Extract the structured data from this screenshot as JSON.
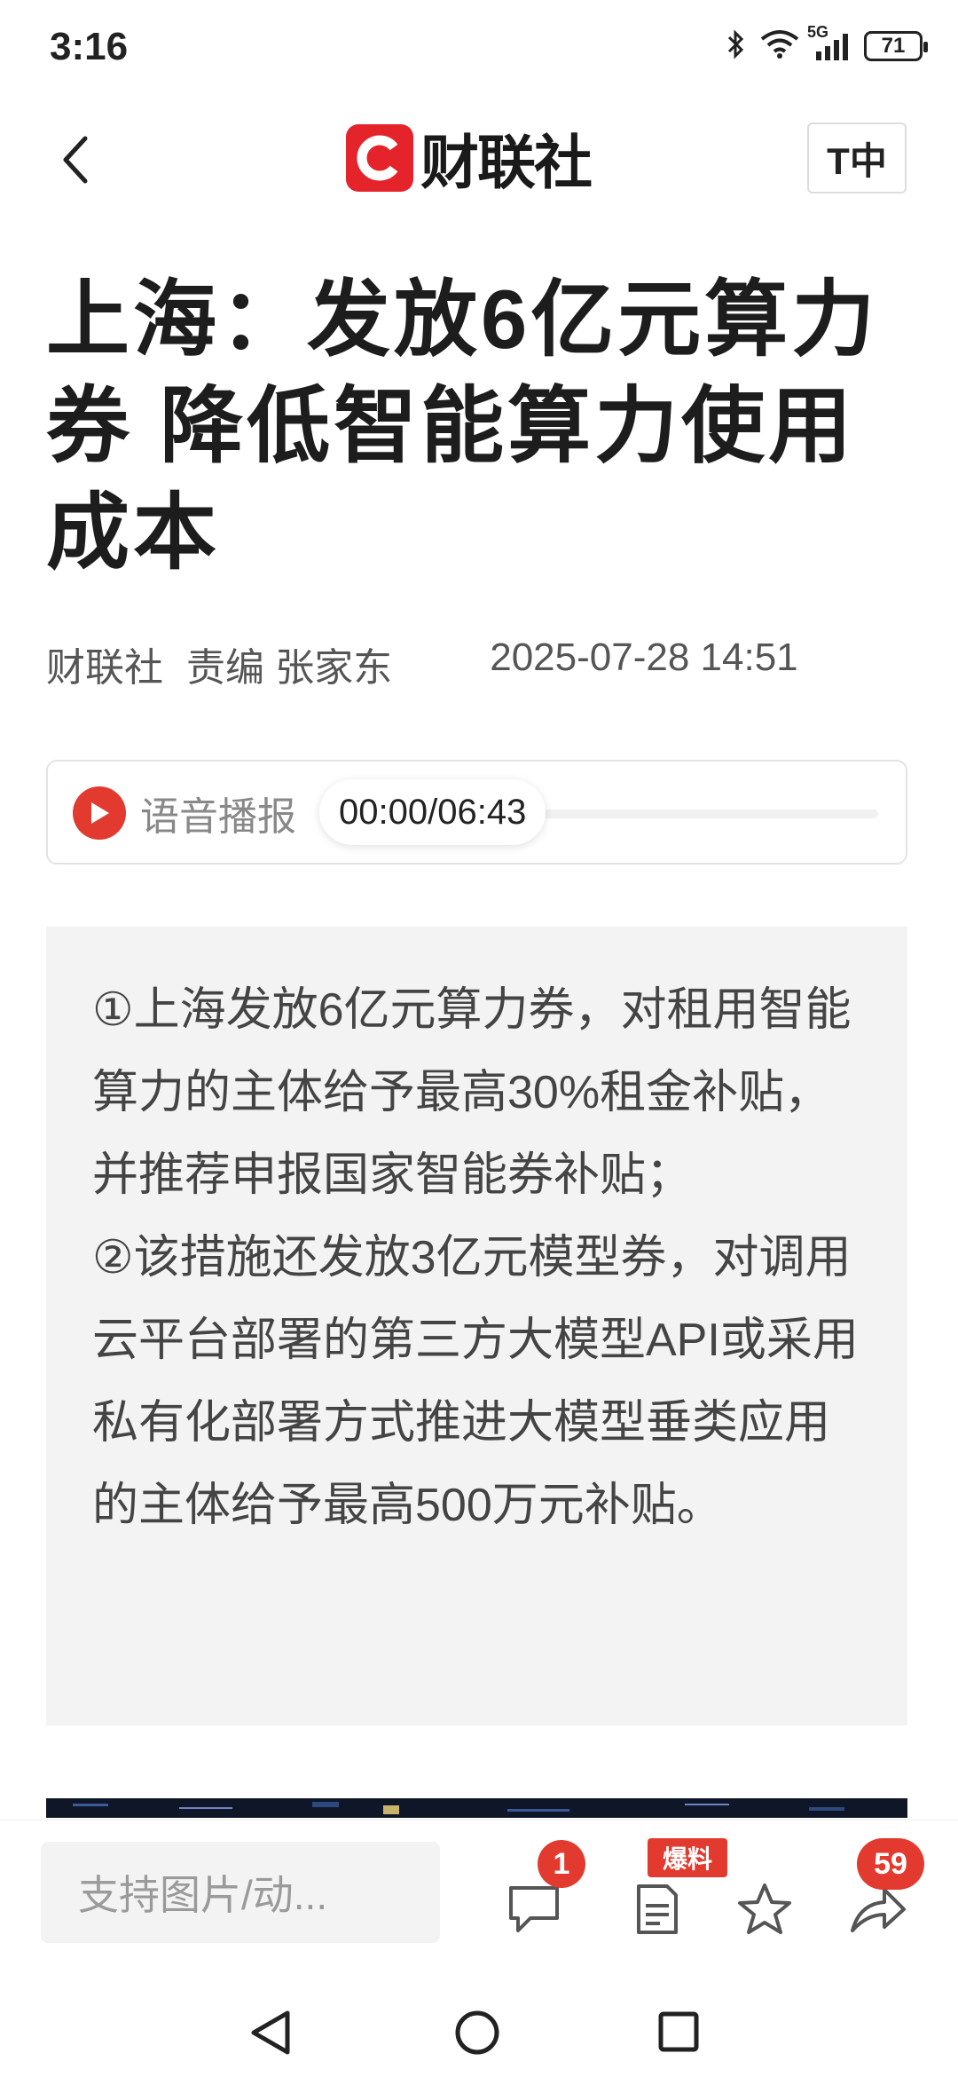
{
  "status_bar": {
    "time": "3:16",
    "network": "5G",
    "battery": "71"
  },
  "header": {
    "logo_text": "财联社",
    "font_toggle": "T中"
  },
  "article": {
    "title": "上海：发放6亿元算力券 降低智能算力使用成本",
    "source": "财联社",
    "editor": "责编 张家东",
    "datetime": "2025-07-28 14:51"
  },
  "audio": {
    "label": "语音播报",
    "time": "00:00/06:43"
  },
  "summary": {
    "text": "①上海发放6亿元算力券，对租用智能算力的主体给予最高30%租金补贴，并推荐申报国家智能券补贴；\n②该措施还发放3亿元模型券，对调用云平台部署的第三方大模型API或采用私有化部署方式推进大模型垂类应用的主体给予最高500万元补贴。"
  },
  "bottom_bar": {
    "comment_placeholder": "支持图片/动...",
    "comment_badge": "1",
    "tip_badge": "爆料",
    "share_badge": "59"
  },
  "colors": {
    "brand_red": "#e5232b",
    "badge_red": "#e23a2e",
    "summary_bg": "#f3f3f3"
  },
  "icons": [
    "back-arrow-icon",
    "comment-icon",
    "report-icon",
    "star-icon",
    "share-icon",
    "nav-back-icon",
    "nav-home-icon",
    "nav-recents-icon"
  ]
}
